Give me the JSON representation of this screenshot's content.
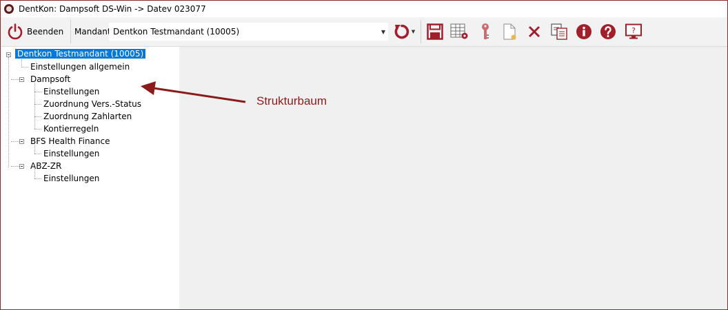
{
  "window": {
    "title": "DentKon: Dampsoft DS-Win -> Datev 023077"
  },
  "toolbar": {
    "beenden_label": "Beenden",
    "mandant_label": "Mandant",
    "mandant_value": "Dentkon Testmandant (10005)",
    "icons": [
      "power-icon",
      "refresh-icon",
      "save-icon",
      "table-settings-icon",
      "key-icon",
      "new-document-icon",
      "delete-icon",
      "copy-icon",
      "info-icon",
      "help-icon",
      "remote-support-icon"
    ],
    "accent_color": "#a01f2a"
  },
  "tree": {
    "root": "Dentkon Testmandant (10005)",
    "items": [
      "Einstellungen allgemein",
      "Dampsoft",
      "Einstellungen",
      "Zuordnung Vers.-Status",
      "Zuordnung Zahlarten",
      "Kontierregeln",
      "BFS Health Finance",
      "Einstellungen",
      "ABZ-ZR",
      "Einstellungen"
    ]
  },
  "annotation": {
    "label": "Strukturbaum",
    "color": "#8b1a1a"
  }
}
